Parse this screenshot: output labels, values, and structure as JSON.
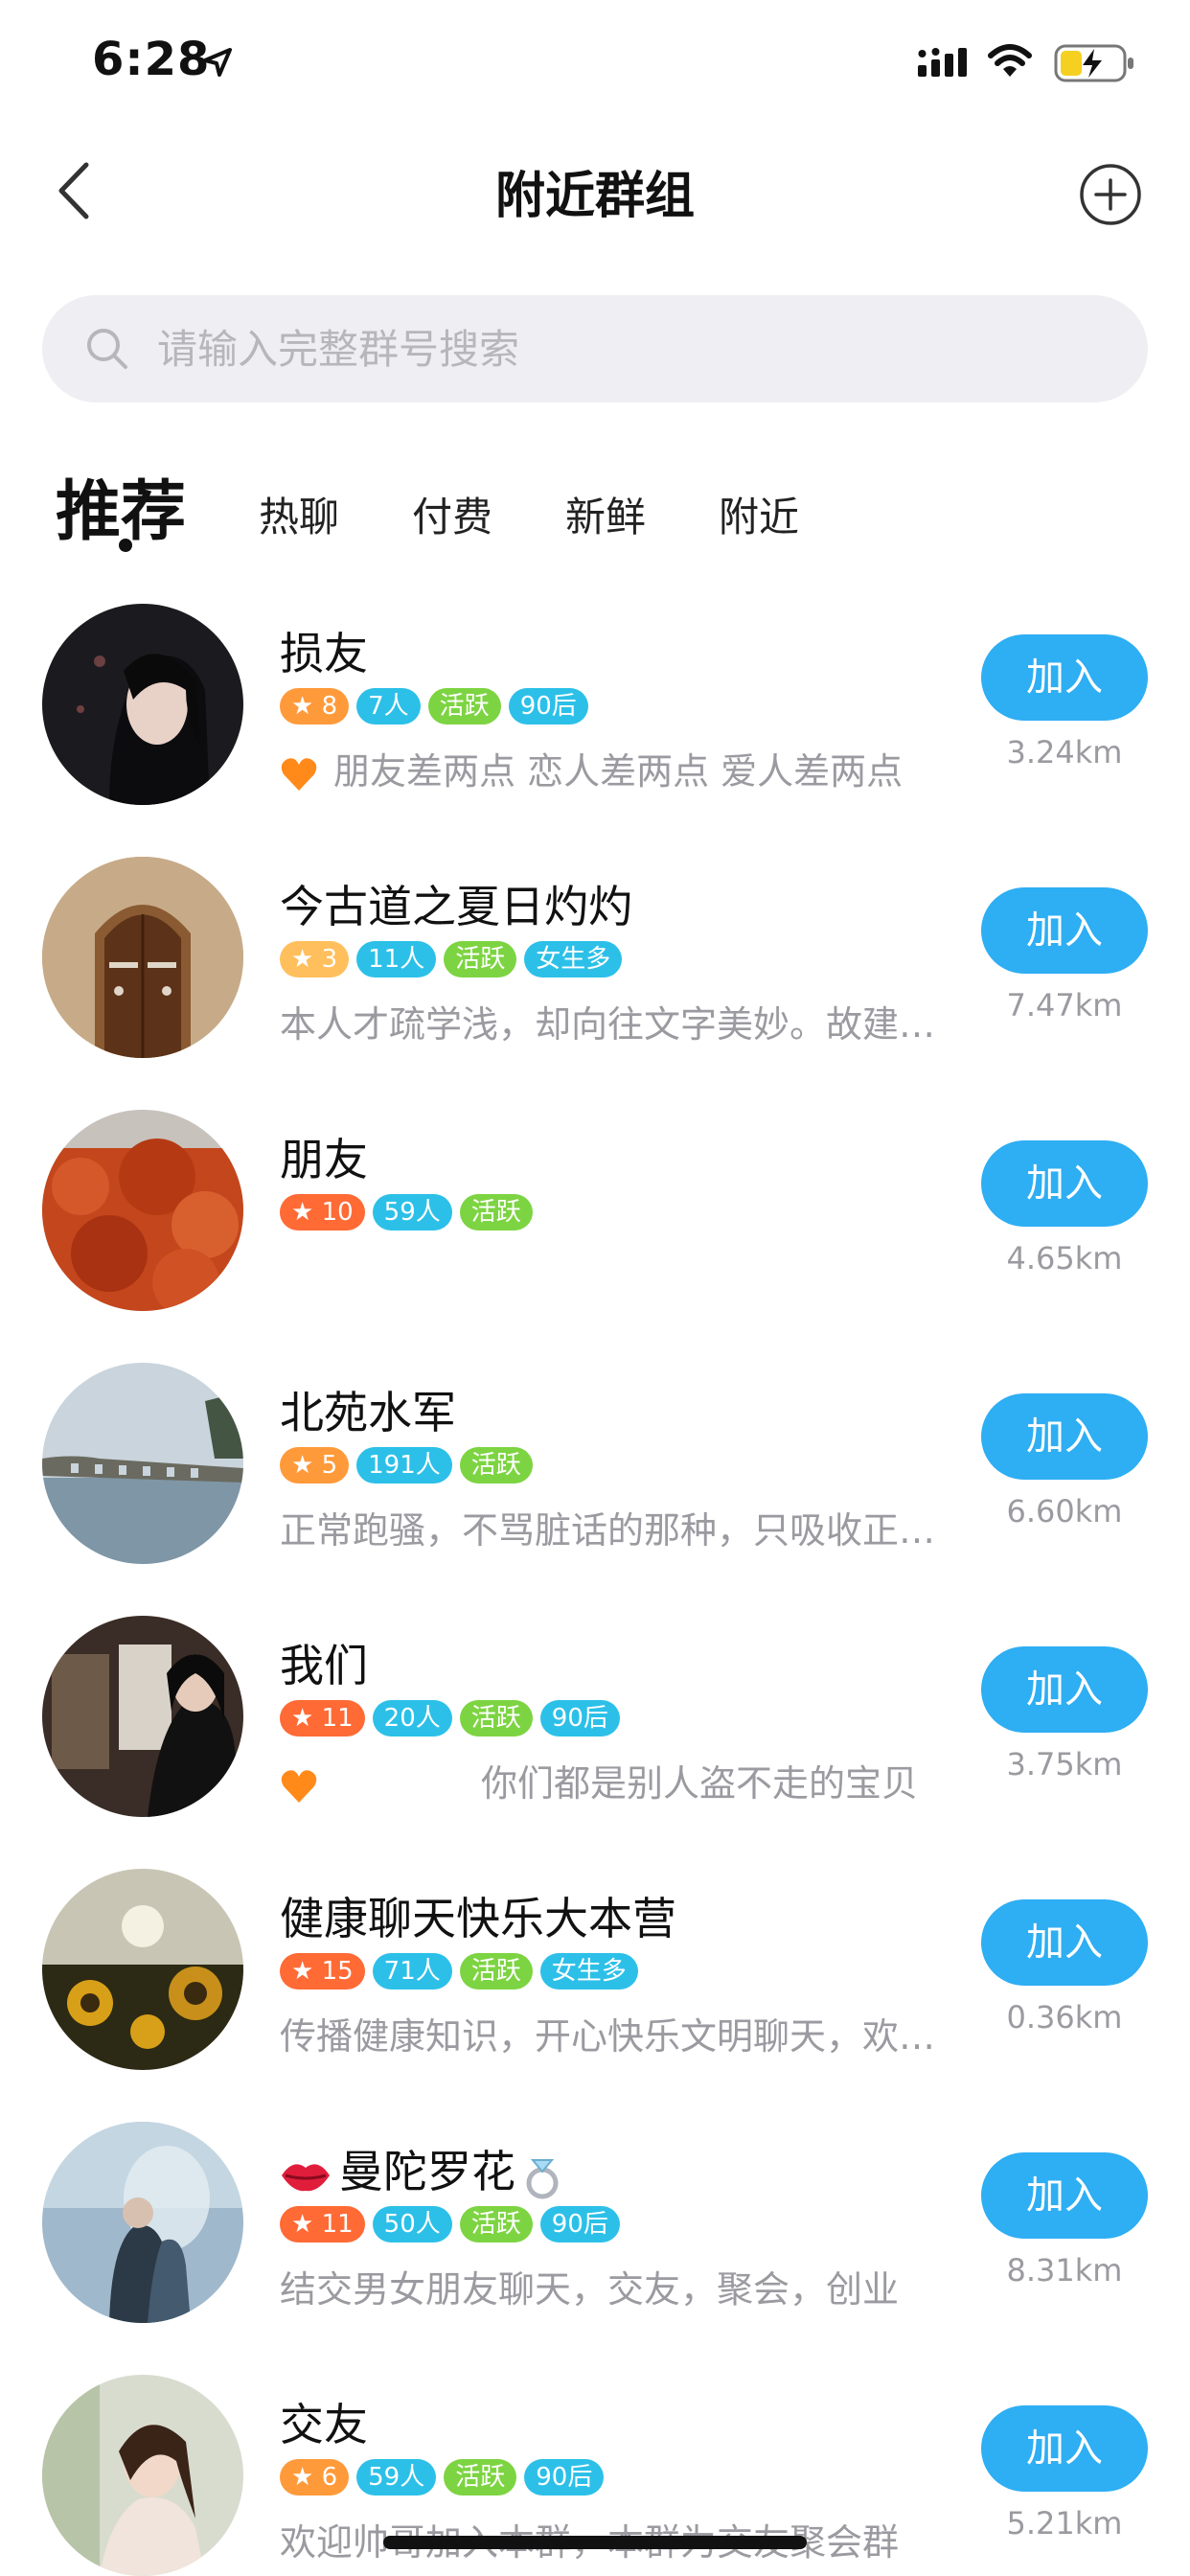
{
  "status_bar": {
    "time": "6:28"
  },
  "nav": {
    "title": "附近群组"
  },
  "search": {
    "placeholder": "请输入完整群号搜索"
  },
  "tabs": [
    {
      "label": "推荐",
      "active": true
    },
    {
      "label": "热聊",
      "active": false
    },
    {
      "label": "付费",
      "active": false
    },
    {
      "label": "新鲜",
      "active": false
    },
    {
      "label": "附近",
      "active": false
    }
  ],
  "join_label": "加入",
  "groups": [
    {
      "name": "损友",
      "level": "8",
      "members": "7人",
      "tags": [
        "活跃",
        "90后"
      ],
      "desc": "朋友差两点 恋人差两点 爱人差两点",
      "has_heart": true,
      "distance": "3.24km"
    },
    {
      "name": "今古道之夏日灼灼",
      "level": "3",
      "members": "11人",
      "tags": [
        "活跃",
        "女生多"
      ],
      "desc": "本人才疏学浅，却向往文字美妙。故建此群",
      "has_heart": false,
      "distance": "7.47km"
    },
    {
      "name": "朋友",
      "level": "10",
      "members": "59人",
      "tags": [
        "活跃"
      ],
      "desc": "",
      "has_heart": false,
      "distance": "4.65km"
    },
    {
      "name": "北苑水军",
      "level": "5",
      "members": "191人",
      "tags": [
        "活跃"
      ],
      "desc": "正常跑骚，不骂脏话的那种，只吸收正能量",
      "has_heart": false,
      "distance": "6.60km"
    },
    {
      "name": "我们",
      "level": "11",
      "members": "20人",
      "tags": [
        "活跃",
        "90后"
      ],
      "desc": "你们都是别人盗不走的宝贝",
      "has_heart": true,
      "distance": "3.75km"
    },
    {
      "name": "健康聊天快乐大本营",
      "level": "15",
      "members": "71人",
      "tags": [
        "活跃",
        "女生多"
      ],
      "desc": "传播健康知识，开心快乐文明聊天，欢迎加入",
      "has_heart": false,
      "distance": "0.36km"
    },
    {
      "name": "曼陀罗花",
      "level": "11",
      "members": "50人",
      "tags": [
        "活跃",
        "90后"
      ],
      "desc": "结交男女朋友聊天，交友，聚会，创业",
      "has_heart": false,
      "distance": "8.31km"
    },
    {
      "name": "交友",
      "level": "6",
      "members": "59人",
      "tags": [
        "活跃",
        "90后"
      ],
      "desc": "欢迎帅哥加入本群，本群为交友聚会群",
      "has_heart": false,
      "distance": "5.21km"
    }
  ]
}
